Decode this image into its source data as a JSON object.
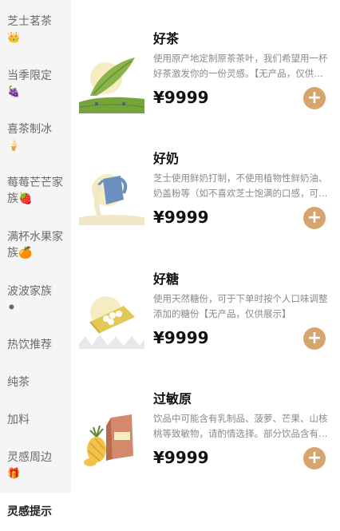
{
  "sidebar": {
    "items": [
      {
        "label": "芝士茗茶",
        "emoji": "👑"
      },
      {
        "label": "当季限定",
        "emoji": "🍇"
      },
      {
        "label": "喜茶制冰",
        "emoji": "🍦"
      },
      {
        "label": "莓莓芒芒家族🍓",
        "emoji": ""
      },
      {
        "label": "满杯水果家族🍊",
        "emoji": ""
      },
      {
        "label": "波波家族",
        "emoji": "⚫"
      },
      {
        "label": "热饮推荐",
        "emoji": ""
      },
      {
        "label": "纯茶",
        "emoji": ""
      },
      {
        "label": "加料",
        "emoji": ""
      },
      {
        "label": "灵感周边",
        "emoji": "🎁"
      },
      {
        "label": "灵感提示",
        "emoji": ""
      }
    ],
    "active_index": 10
  },
  "products": [
    {
      "name": "好茶",
      "desc": "使用原产地定制原茶茶叶，我们希望用一杯好茶激发你的一份灵感。【无产品，仅供展示】",
      "price": "¥9999",
      "add_label": "+",
      "icon": "tea-leaf-icon"
    },
    {
      "name": "好奶",
      "desc": "芝士使用鲜奶打制，不使用植物性鲜奶油、奶盖粉等（如不喜欢芝士饱满的口感，可选择去芝士）",
      "price": "¥9999",
      "add_label": "+",
      "icon": "milk-jug-icon"
    },
    {
      "name": "好糖",
      "desc": "使用天然糖份，可于下单时按个人口味调整添加的糖份【无产品，仅供展示】",
      "price": "¥9999",
      "add_label": "+",
      "icon": "sugar-tray-icon"
    },
    {
      "name": "过敏原",
      "desc": "饮品中可能含有乳制品、菠萝、芒果、山核桃等致敏物，请酌情选择。部分饮品含有坚果",
      "price": "¥9999",
      "add_label": "+",
      "icon": "allergen-icon"
    }
  ],
  "colors": {
    "accent": "#d6a56d",
    "sidebar_bg": "#f5f5f5"
  }
}
